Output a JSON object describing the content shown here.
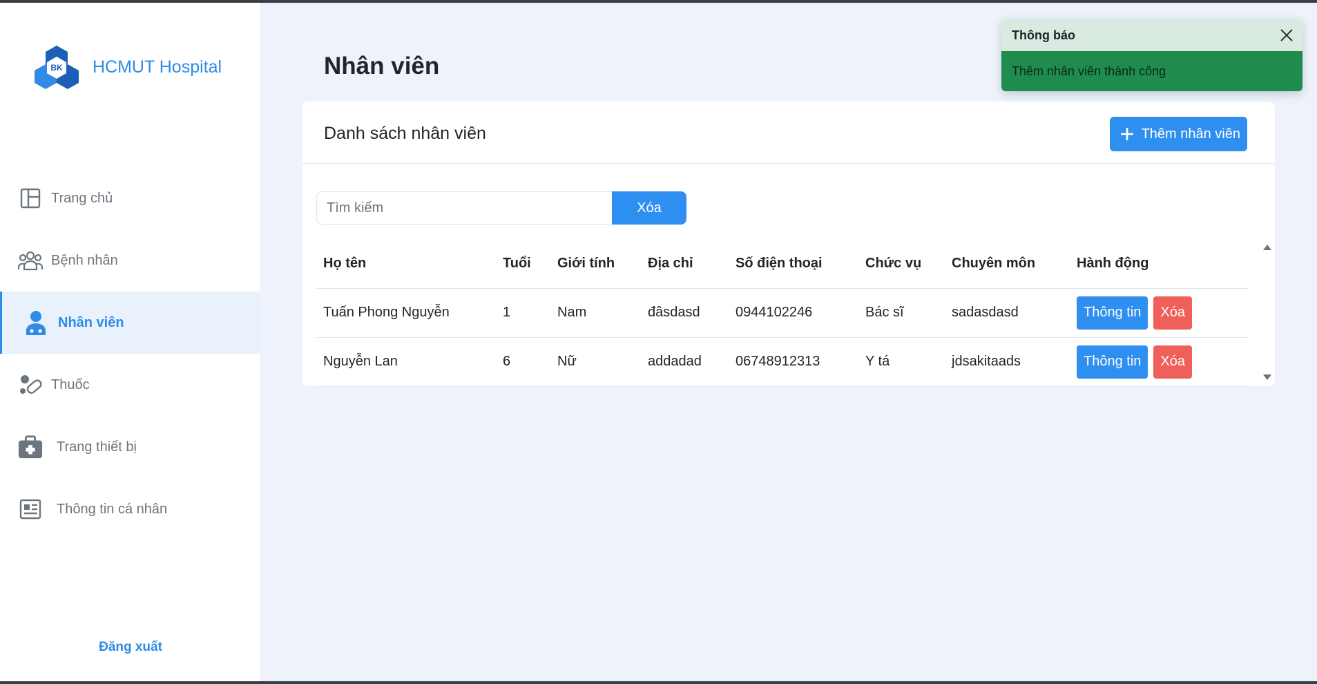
{
  "app": {
    "name": "HCMUT Hospital",
    "logo_text": "BK"
  },
  "sidebar": {
    "items": [
      {
        "label": "Trang chủ",
        "icon": "layout-icon",
        "active": false
      },
      {
        "label": "Bệnh nhân",
        "icon": "people-icon",
        "active": false
      },
      {
        "label": "Nhân viên",
        "icon": "doctor-icon",
        "active": true
      },
      {
        "label": "Thuốc",
        "icon": "pills-icon",
        "active": false
      },
      {
        "label": "Trang thiết bị",
        "icon": "medical-kit-icon",
        "active": false
      },
      {
        "label": "Thông tin cá nhân",
        "icon": "id-card-icon",
        "active": false
      }
    ],
    "logout_label": "Đăng xuất"
  },
  "page": {
    "title": "Nhân viên"
  },
  "card": {
    "title": "Danh sách nhân viên",
    "add_button_label": "Thêm nhân viên"
  },
  "search": {
    "placeholder": "Tìm kiếm",
    "clear_label": "Xóa"
  },
  "table": {
    "headers": [
      "Họ tên",
      "Tuổi",
      "Giới tính",
      "Địa chỉ",
      "Số điện thoại",
      "Chức vụ",
      "Chuyên môn",
      "Hành động"
    ],
    "rows": [
      {
        "name": "Tuấn Phong Nguyễn",
        "age": "1",
        "gender": "Nam",
        "address": "đâsdasd",
        "phone": "0944102246",
        "position": "Bác sĩ",
        "specialty": "sadasdasd",
        "info_label": "Thông tin",
        "delete_label": "Xóa"
      },
      {
        "name": "Nguyễn Lan",
        "age": "6",
        "gender": "Nữ",
        "address": "addadad",
        "phone": "06748912313",
        "position": "Y tá",
        "specialty": "jdsakitaads",
        "info_label": "Thông tin",
        "delete_label": "Xóa"
      }
    ]
  },
  "toast": {
    "title": "Thông báo",
    "message": "Thêm nhân viên thành công"
  },
  "colors": {
    "primary": "#2f8ff0",
    "danger": "#f0605b",
    "success": "#1f8b4c",
    "sidebar_active_bg": "#e8f1fc"
  }
}
